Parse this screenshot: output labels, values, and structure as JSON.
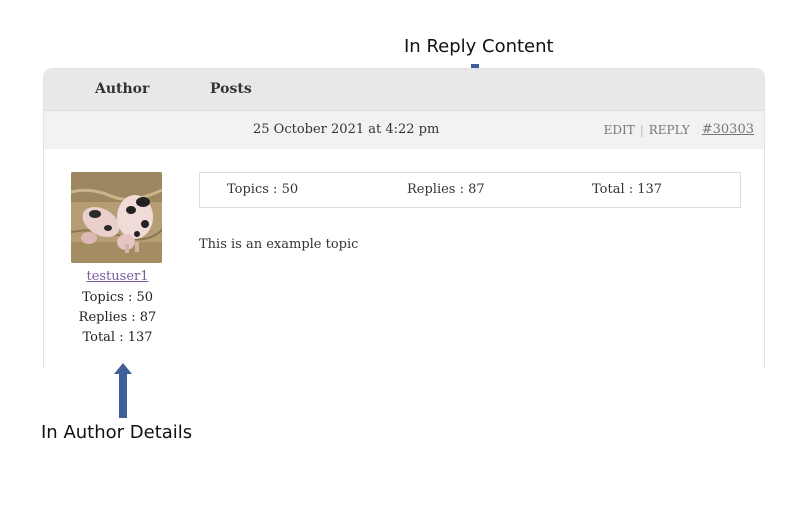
{
  "annotations": {
    "reply_content": "In Reply Content",
    "author_details": "In Author Details"
  },
  "header": {
    "author_label": "Author",
    "posts_label": "Posts"
  },
  "post_meta": {
    "date": "25 October 2021 at 4:22 pm",
    "edit_label": "EDIT",
    "reply_label": "REPLY",
    "permalink": "#30303"
  },
  "author": {
    "name": "testuser1",
    "topics": "Topics : 50",
    "replies": "Replies : 87",
    "total": "Total : 137"
  },
  "reply_stats": {
    "topics": "Topics : 50",
    "replies": "Replies : 87",
    "total": "Total : 137"
  },
  "content": {
    "text": "This is an example topic"
  },
  "colors": {
    "arrow": "#3f5f99",
    "link": "#7a5a9e"
  }
}
